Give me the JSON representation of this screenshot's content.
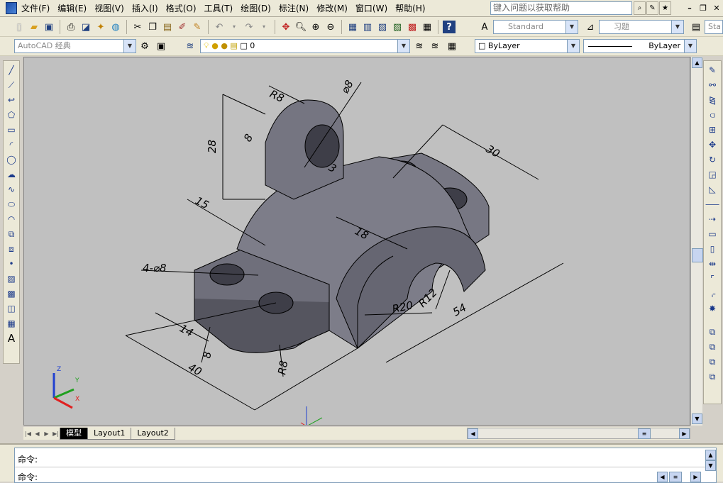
{
  "menu": {
    "items": [
      "文件(F)",
      "编辑(E)",
      "视图(V)",
      "插入(I)",
      "格式(O)",
      "工具(T)",
      "绘图(D)",
      "标注(N)",
      "修改(M)",
      "窗口(W)",
      "帮助(H)"
    ],
    "help_placeholder": "键入问题以获取帮助"
  },
  "toolbar": {
    "text_style": "Standard",
    "dim_style": "习题",
    "table_style": "Sta",
    "workspace": "AutoCAD 经典",
    "layer": "0",
    "color": "ByLayer",
    "linetype": "ByLayer"
  },
  "layouts": {
    "tabs": [
      "模型",
      "Layout1",
      "Layout2"
    ],
    "active": "模型"
  },
  "command": {
    "line1": "命令:",
    "line2": "命令:"
  },
  "drawing": {
    "dims": {
      "r8_top": "R8",
      "d8_top": "⌀8",
      "h28": "28",
      "w8": "8",
      "w3": "3",
      "w15": "15",
      "w30": "30",
      "w18": "18",
      "holes": "4-⌀8",
      "r20": "R20",
      "r12": "R12",
      "w54": "54",
      "w14": "14",
      "w8b": "8",
      "w40": "40",
      "r8_bottom": "R8"
    },
    "ucs": {
      "x": "X",
      "y": "Y",
      "z": "Z"
    }
  },
  "colors": {
    "canvas_bg": "#c0c0c0",
    "part_fill": "#6e6e7a",
    "part_shade": "#4a4a56",
    "ucs_x": "#e02020",
    "ucs_y": "#20a020",
    "ucs_z": "#2040d0"
  }
}
